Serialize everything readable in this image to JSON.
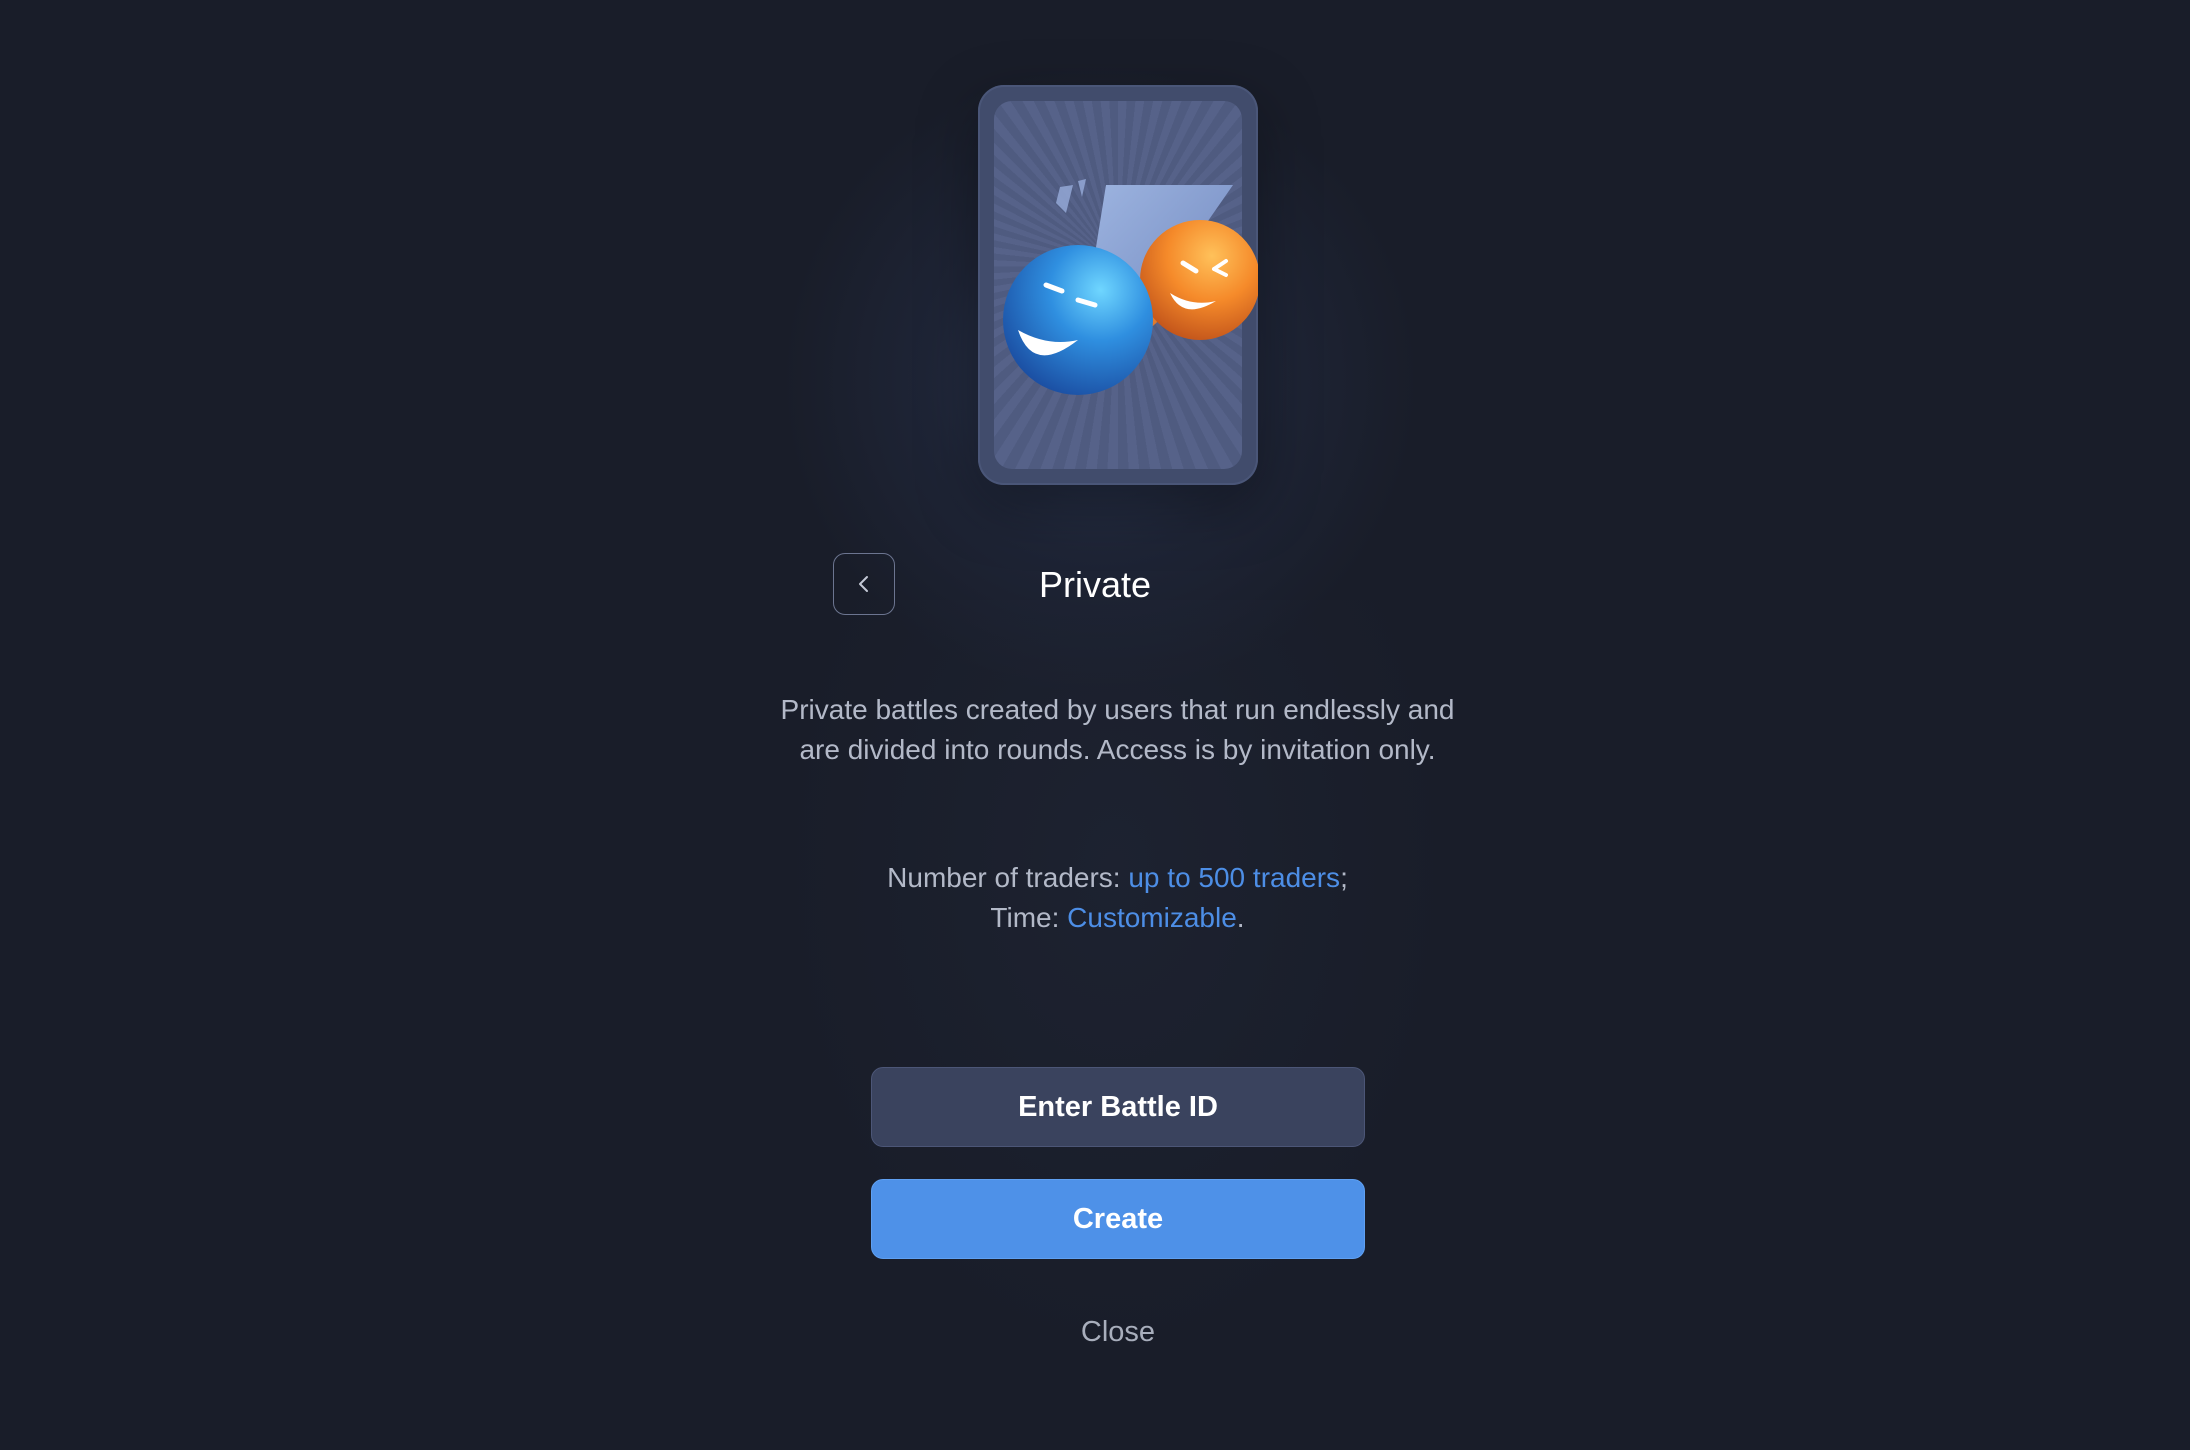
{
  "dialog": {
    "title": "Private",
    "description": "Private battles created by users that run endlessly and are divided into rounds. Access is by invitation only.",
    "traders_label": "Number of traders: ",
    "traders_value": "up to 500 traders",
    "traders_suffix": ";",
    "time_label": "Time: ",
    "time_value": "Customizable",
    "time_suffix": ".",
    "enter_button": "Enter Battle ID",
    "create_button": "Create",
    "close_link": "Close"
  },
  "icons": {
    "back": "chevron-left-icon",
    "illustration": "battle-smileys-illustration"
  },
  "colors": {
    "background": "#191d29",
    "accent": "#4d8ee6",
    "primary_button": "#4e91e8",
    "secondary_button": "#3a435e",
    "card": "#414c6c"
  }
}
